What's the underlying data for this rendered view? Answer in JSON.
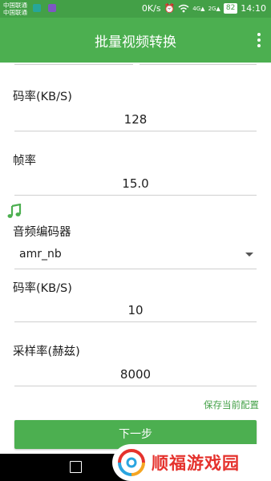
{
  "status_bar": {
    "carrier_1": "中国联通",
    "carrier_2": "中国联通",
    "speed": "0K/s",
    "network_1": "4G",
    "network_2": "2G",
    "battery": "82",
    "time": "14:10"
  },
  "app_bar": {
    "title": "批量视频转换"
  },
  "form": {
    "video_bitrate_label": "码率(KB/S)",
    "video_bitrate_value": "128",
    "framerate_label": "帧率",
    "framerate_value": "15.0",
    "audio_codec_label": "音频编码器",
    "audio_codec_value": "amr_nb",
    "audio_bitrate_label": "码率(KB/S)",
    "audio_bitrate_value": "10",
    "samplerate_label": "采样率(赫兹)",
    "samplerate_value": "8000"
  },
  "actions": {
    "save_config": "保存当前配置",
    "next": "下一步"
  },
  "watermark": {
    "text": "顺福游戏园"
  },
  "colors": {
    "primary": "#4caf50",
    "status": "#43a047",
    "watermark": "#e5322d"
  }
}
